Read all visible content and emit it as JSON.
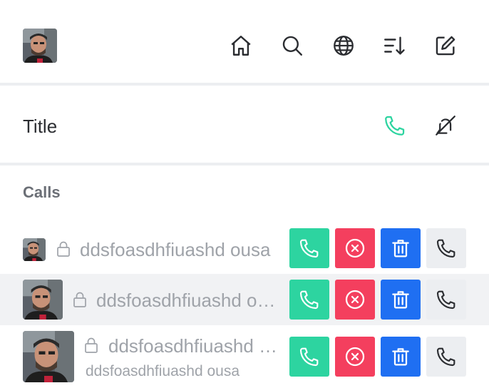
{
  "header": {
    "avatar": "user-avatar",
    "icons": [
      "home-icon",
      "search-icon",
      "globe-icon",
      "sort-icon",
      "edit-icon"
    ]
  },
  "title_bar": {
    "title": "Title",
    "call_icon": "phone-icon",
    "mute_icon": "bell-off-icon"
  },
  "section": {
    "title": "Calls"
  },
  "calls": [
    {
      "name": "ddsfoasdhfiuashd ousa",
      "subtitle": "",
      "locked": true
    },
    {
      "name": "ddsfoasdhfiuashd ousa",
      "subtitle": "",
      "locked": true
    },
    {
      "name": "ddsfoasdhfiuashd ousa",
      "subtitle": "ddsfoasdhfiuashd ousa",
      "locked": true
    }
  ],
  "actions": [
    "accept-call",
    "decline-call",
    "delete-call",
    "call-back"
  ],
  "colors": {
    "accent_green": "#2dd4a0",
    "danger_red": "#f43f5e",
    "primary_blue": "#1f6ff2",
    "neutral_gray": "#eceef1",
    "muted_text": "#9fa3a9"
  }
}
